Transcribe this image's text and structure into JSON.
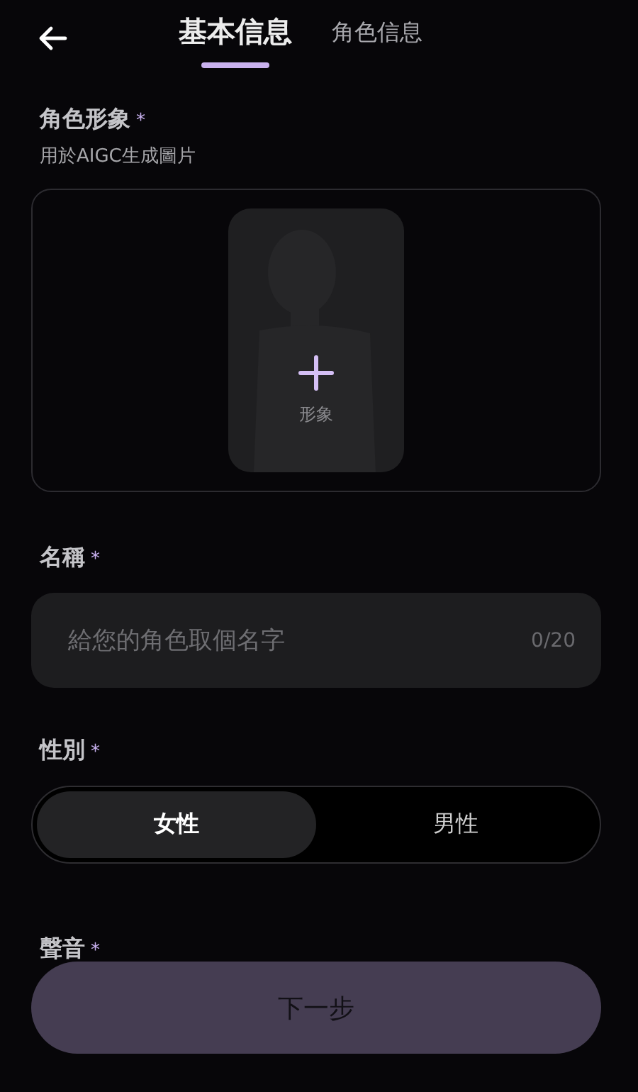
{
  "tabs": [
    {
      "label": "基本信息",
      "selected": true
    },
    {
      "label": "角色信息",
      "selected": false
    }
  ],
  "image_section": {
    "label": "角色形象",
    "required_mark": "*",
    "hint": "用於AIGC生成圖片",
    "upload_label": "形象"
  },
  "name_section": {
    "label": "名稱",
    "required_mark": "*",
    "placeholder": "給您的角色取個名字",
    "counter": "0/20"
  },
  "gender_section": {
    "label": "性別",
    "required_mark": "*",
    "options": [
      {
        "label": "女性",
        "selected": true
      },
      {
        "label": "男性",
        "selected": false
      }
    ]
  },
  "voice_section": {
    "label": "聲音",
    "required_mark": "*"
  },
  "next_button": {
    "label": "下一步"
  }
}
